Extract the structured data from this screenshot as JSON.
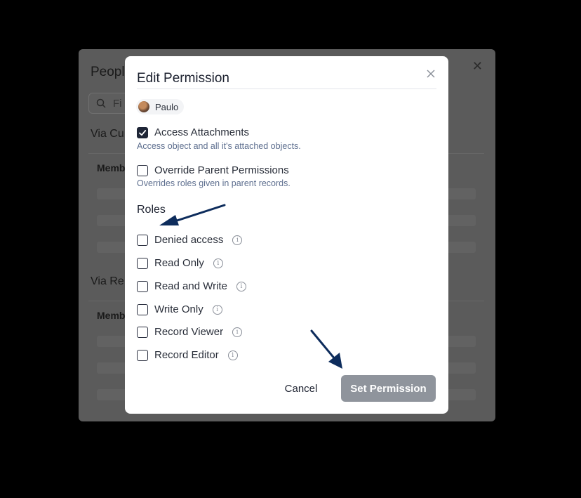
{
  "background": {
    "title": "Peopl",
    "search_placeholder": "Fi",
    "section_custom": "Via Cu",
    "section_related": "Via Re",
    "members_header": "Memb"
  },
  "modal": {
    "title": "Edit Permission",
    "user": {
      "name": "Paulo"
    },
    "access_attachments": {
      "label": "Access Attachments",
      "description": "Access object and all it's attached objects.",
      "checked": true
    },
    "override_parent": {
      "label": "Override Parent Permissions",
      "description": "Overrides roles given in parent records.",
      "checked": false
    },
    "roles_title": "Roles",
    "roles": [
      {
        "label": "Denied access",
        "checked": false
      },
      {
        "label": "Read Only",
        "checked": false
      },
      {
        "label": "Read and Write",
        "checked": false
      },
      {
        "label": "Write Only",
        "checked": false
      },
      {
        "label": "Record Viewer",
        "checked": false
      },
      {
        "label": "Record Editor",
        "checked": false
      }
    ],
    "cancel_label": "Cancel",
    "submit_label": "Set Permission"
  },
  "colors": {
    "accent_dark": "#1f2637",
    "description_text": "#5e6f8f",
    "submit_disabled": "#8f949c",
    "annotation_arrow": "#0d2c5c"
  },
  "info_glyph": "i"
}
